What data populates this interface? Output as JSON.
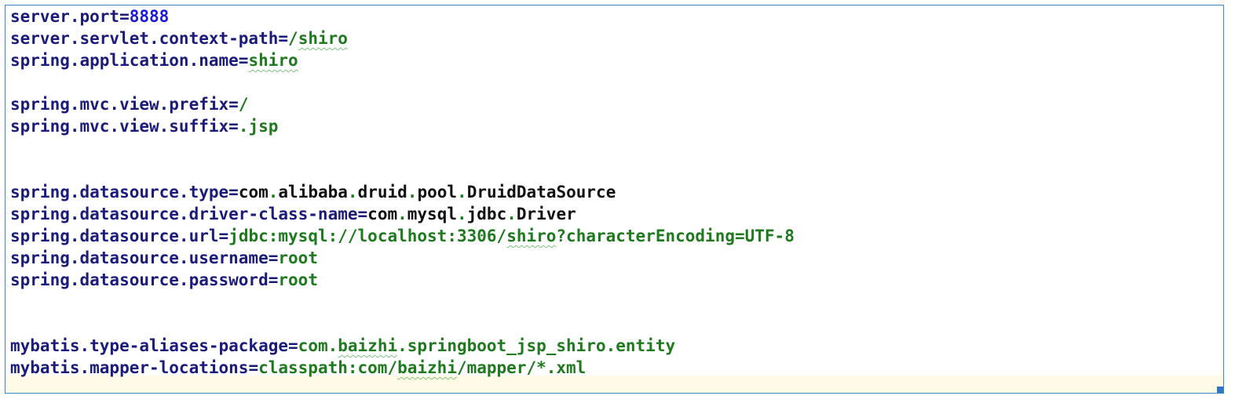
{
  "lines": [
    {
      "key": "server.port",
      "eq": "=",
      "val": "8888"
    },
    {
      "key": "server.servlet.context-path",
      "eq": "=",
      "val_a": "/",
      "val_b": "shiro"
    },
    {
      "key": "spring.application.name",
      "eq": "=",
      "val": "shiro"
    },
    {
      "key": "spring.mvc.view.prefix",
      "eq": "=",
      "val": "/"
    },
    {
      "key": "spring.mvc.view.suffix",
      "eq": "=",
      "val": ".jsp"
    },
    {
      "key": "spring.datasource.type",
      "eq": "=",
      "p1": "com",
      "d1": ".",
      "p2": "alibaba",
      "d2": ".",
      "p3": "druid",
      "d3": ".",
      "p4": "pool",
      "d4": ".",
      "p5": "DruidDataSource"
    },
    {
      "key": "spring.datasource.driver-class-name",
      "eq": "=",
      "p1": "com",
      "d1": ".",
      "p2": "mysql",
      "d2": ".",
      "p3": "jdbc",
      "d3": ".",
      "p4": "Driver"
    },
    {
      "key": "spring.datasource.url",
      "eq": "=",
      "val_a": "jdbc:mysql://localhost:3306/",
      "val_b": "shiro",
      "val_c": "?characterEncoding=UTF-8"
    },
    {
      "key": "spring.datasource.username",
      "eq": "=",
      "val": "root"
    },
    {
      "key": "spring.datasource.password",
      "eq": "=",
      "val": "root"
    },
    {
      "key": "mybatis.type-aliases-package",
      "eq": "=",
      "val_a": "com.",
      "val_b": "baizhi",
      "val_c": ".springboot_jsp_shiro.entity"
    },
    {
      "key": "mybatis.mapper-locations",
      "eq": "=",
      "val_a": "classpath:com/",
      "val_b": "baizhi",
      "val_c": "/mapper/*.xml"
    }
  ],
  "colors": {
    "key": "#1b1b7a",
    "value": "#1f7a1f",
    "number": "#1a1adc",
    "plain": "#111111",
    "border": "#3a87c8",
    "current_line": "#fffbe6"
  }
}
